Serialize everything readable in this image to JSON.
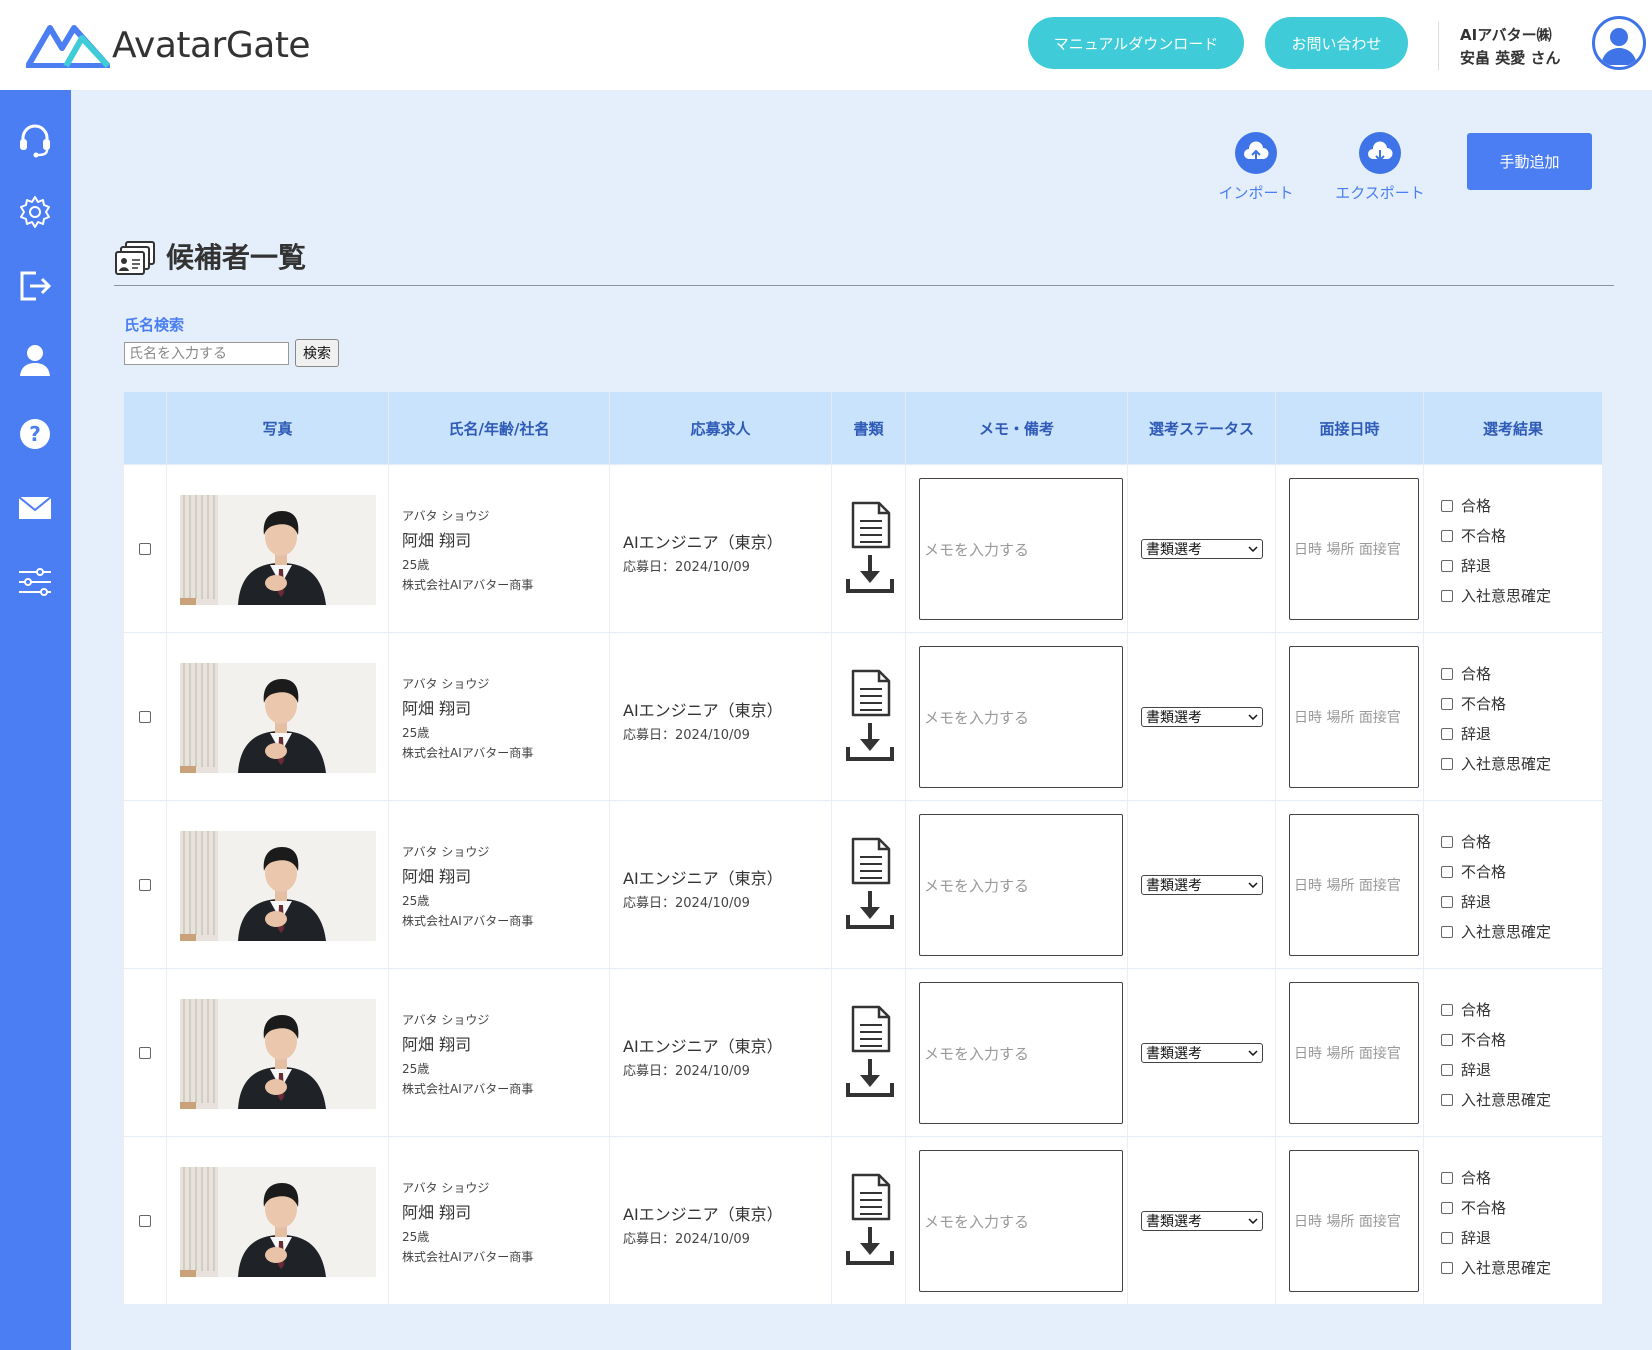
{
  "header": {
    "logo_text": "AvatarGate",
    "manual_button": "マニュアルダウンロード",
    "contact_button": "お問い合わせ",
    "user_company": "AIアバター㈱",
    "user_name": "安畠 英愛 さん"
  },
  "sidebar": {
    "items": [
      {
        "icon": "headset-icon"
      },
      {
        "icon": "gear-icon"
      },
      {
        "icon": "logout-icon"
      },
      {
        "icon": "user-icon"
      },
      {
        "icon": "help-icon"
      },
      {
        "icon": "mail-icon"
      },
      {
        "icon": "sliders-icon"
      }
    ]
  },
  "toolbar": {
    "import_label": "インポート",
    "export_label": "エクスポート",
    "add_label": "手動追加"
  },
  "page": {
    "title": "候補者一覧"
  },
  "search": {
    "label": "氏名検索",
    "placeholder": "氏名を入力する",
    "button": "検索"
  },
  "table": {
    "headers": [
      "写真",
      "氏名/年齢/社名",
      "応募求人",
      "書類",
      "メモ・備考",
      "選考ステータス",
      "面接日時",
      "選考結果"
    ],
    "rows": [
      {
        "kana": "アバタ ショウジ",
        "name": "阿畑 翔司",
        "age": "25歳",
        "company": "株式会社AIアバター商事",
        "job": "AIエンジニア（東京）",
        "applied": "応募日：2024/10/09",
        "memo_placeholder": "メモを入力する",
        "status": "書類選考",
        "interview_placeholder": "日時 場所 面接官",
        "results": [
          "合格",
          "不合格",
          "辞退",
          "入社意思確定"
        ]
      },
      {
        "kana": "アバタ ショウジ",
        "name": "阿畑 翔司",
        "age": "25歳",
        "company": "株式会社AIアバター商事",
        "job": "AIエンジニア（東京）",
        "applied": "応募日：2024/10/09",
        "memo_placeholder": "メモを入力する",
        "status": "書類選考",
        "interview_placeholder": "日時 場所 面接官",
        "results": [
          "合格",
          "不合格",
          "辞退",
          "入社意思確定"
        ]
      },
      {
        "kana": "アバタ ショウジ",
        "name": "阿畑 翔司",
        "age": "25歳",
        "company": "株式会社AIアバター商事",
        "job": "AIエンジニア（東京）",
        "applied": "応募日：2024/10/09",
        "memo_placeholder": "メモを入力する",
        "status": "書類選考",
        "interview_placeholder": "日時 場所 面接官",
        "results": [
          "合格",
          "不合格",
          "辞退",
          "入社意思確定"
        ]
      },
      {
        "kana": "アバタ ショウジ",
        "name": "阿畑 翔司",
        "age": "25歳",
        "company": "株式会社AIアバター商事",
        "job": "AIエンジニア（東京）",
        "applied": "応募日：2024/10/09",
        "memo_placeholder": "メモを入力する",
        "status": "書類選考",
        "interview_placeholder": "日時 場所 面接官",
        "results": [
          "合格",
          "不合格",
          "辞退",
          "入社意思確定"
        ]
      },
      {
        "kana": "アバタ ショウジ",
        "name": "阿畑 翔司",
        "age": "25歳",
        "company": "株式会社AIアバター商事",
        "job": "AIエンジニア（東京）",
        "applied": "応募日：2024/10/09",
        "memo_placeholder": "メモを入力する",
        "status": "書類選考",
        "interview_placeholder": "日時 場所 面接官",
        "results": [
          "合格",
          "不合格",
          "辞退",
          "入社意思確定"
        ]
      }
    ]
  },
  "colors": {
    "sidebar": "#4a7ef2",
    "header_button": "#3fcbd8",
    "table_header": "#c9e3fc",
    "page_background": "#e4effb",
    "accent_text": "#4a7ef2"
  }
}
